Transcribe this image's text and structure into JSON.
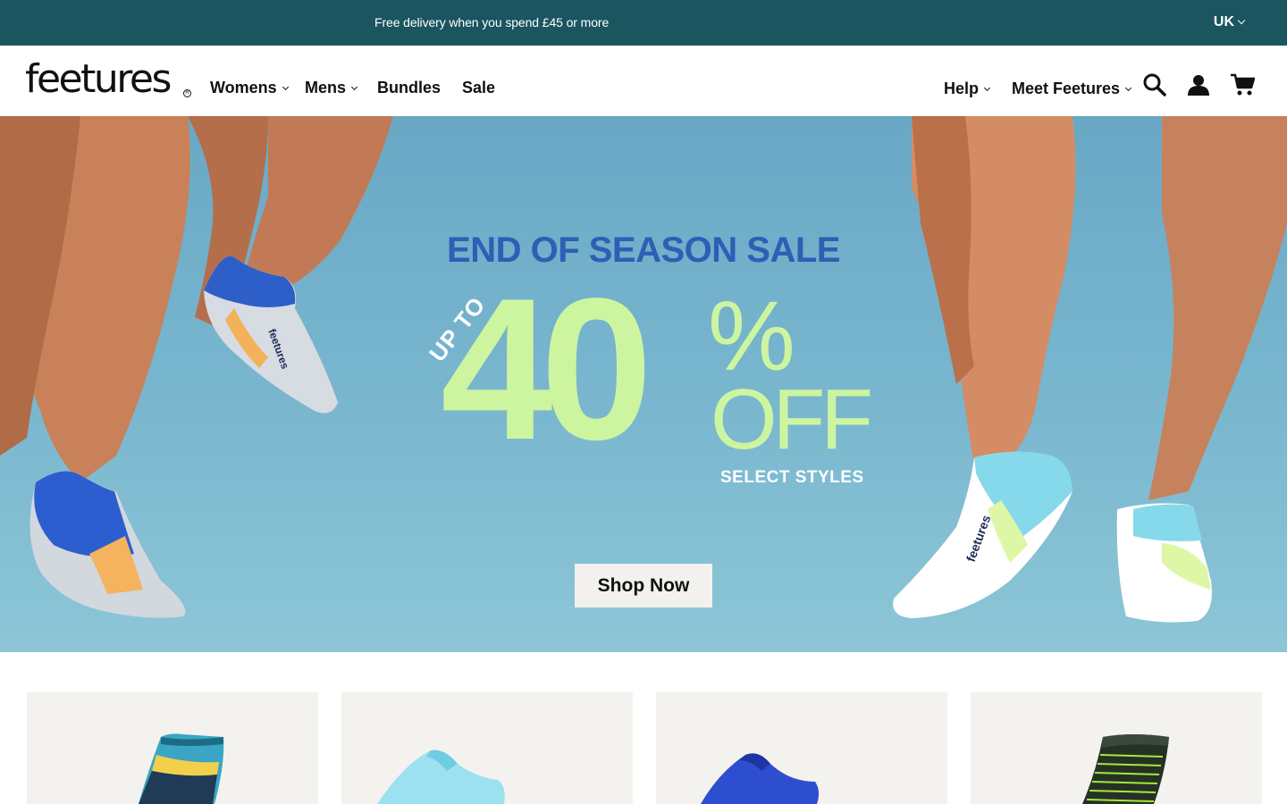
{
  "promo": {
    "text": "Free delivery when you spend £45 or more",
    "region": "UK"
  },
  "header": {
    "logo": "feetures",
    "nav_left": [
      "Womens",
      "Mens",
      "Bundles",
      "Sale"
    ],
    "nav_right": [
      "Help",
      "Meet Feetures"
    ],
    "icons": [
      "search-icon",
      "account-icon",
      "cart-icon"
    ]
  },
  "hero": {
    "title": "END OF SEASON SALE",
    "up_to": "UP TO",
    "percent_number": "40",
    "percent_sign": "%",
    "off": "OFF",
    "select_styles": "SELECT STYLES",
    "cta": "Shop Now"
  },
  "colors": {
    "promo_bg": "#1a5560",
    "hero_bg": "#7ab7cf",
    "hero_title": "#2d5fb5",
    "hero_accent": "#cdf5a0",
    "tile_bg": "#f4f2ee"
  },
  "products": [
    {
      "name": "crew-sock-teal"
    },
    {
      "name": "no-show-sock-aqua"
    },
    {
      "name": "no-show-sock-blue"
    },
    {
      "name": "crew-sock-black-green"
    }
  ]
}
